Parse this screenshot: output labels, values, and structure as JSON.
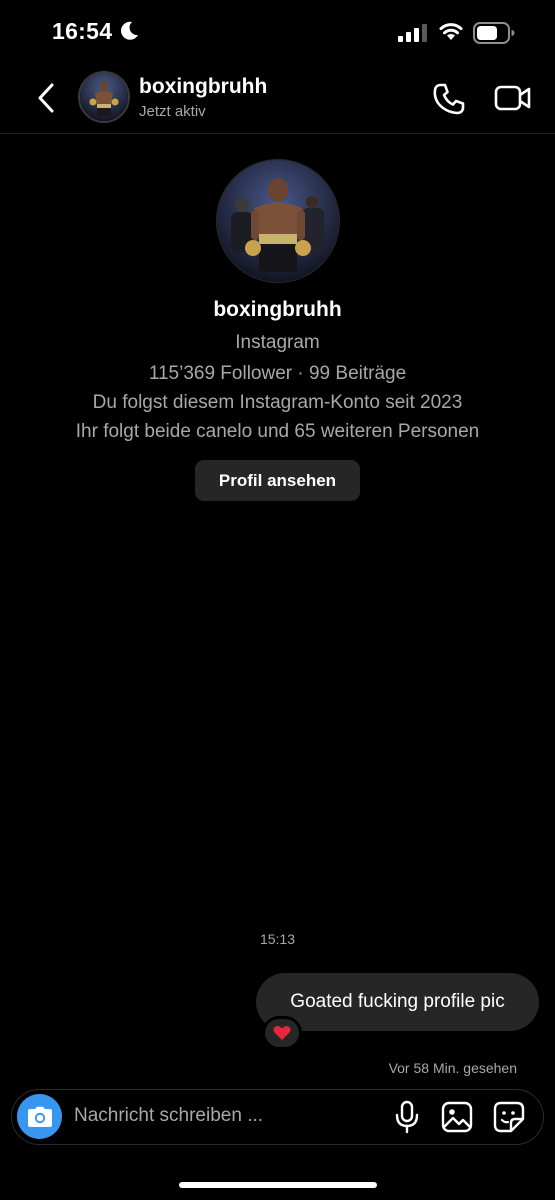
{
  "status_bar": {
    "time": "16:54"
  },
  "header": {
    "username": "boxingbruhh",
    "status": "Jetzt aktiv"
  },
  "profile": {
    "username": "boxingbruhh",
    "subtitle": "Instagram",
    "stats": "115’369 Follower · 99 Beiträge",
    "following_since": "Du folgst diesem Instagram-Konto seit 2023",
    "mutual": "Ihr folgt beide canelo und 65 weiteren Personen",
    "view_profile_label": "Profil ansehen"
  },
  "messages": {
    "timestamp": "15:13",
    "items": [
      {
        "text": "Goated fucking profile pic",
        "reaction": "❤️"
      }
    ],
    "seen": "Vor 58 Min. gesehen"
  },
  "composer": {
    "placeholder": "Nachricht schreiben ..."
  },
  "colors": {
    "background": "#000000",
    "bubble": "#262626",
    "accent": "#3797f0",
    "muted_text": "#a8a8a8",
    "reaction_heart": "#e8263d"
  },
  "icons": [
    "moon-icon",
    "cellular-signal-icon",
    "wifi-icon",
    "battery-icon",
    "back-chevron-icon",
    "phone-icon",
    "video-camera-icon",
    "camera-icon",
    "microphone-icon",
    "gallery-icon",
    "sticker-icon"
  ]
}
